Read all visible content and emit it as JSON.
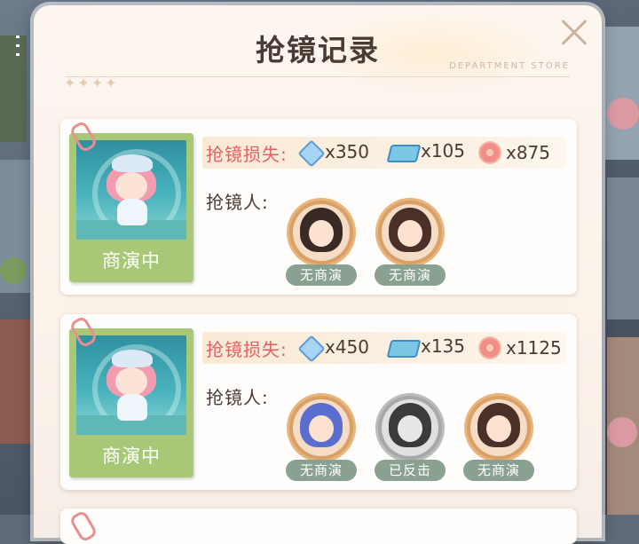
{
  "header": {
    "title": "抢镜记录",
    "subtitle": "DEPARTMENT STORE",
    "decoration": "✦✦✦✦"
  },
  "labels": {
    "loss": "抢镜损失:",
    "grabbers": "抢镜人:"
  },
  "resource_icons": [
    "crystal-icon",
    "cash-icon",
    "flower-icon"
  ],
  "records": [
    {
      "status": "商演中",
      "losses": [
        "x350",
        "x105",
        "x875"
      ],
      "grabbers": [
        {
          "tag": "无商演",
          "hair_color": "#3a2a25"
        },
        {
          "tag": "无商演",
          "hair_color": "#4a3029"
        }
      ]
    },
    {
      "status": "商演中",
      "losses": [
        "x450",
        "x135",
        "x1125"
      ],
      "grabbers": [
        {
          "tag": "无商演",
          "hair_color": "#5a6ed0"
        },
        {
          "tag": "已反击",
          "hair_color": "#3b3b3b"
        },
        {
          "tag": "无商演",
          "hair_color": "#4a3029"
        }
      ]
    }
  ],
  "colors": {
    "loss_label": "#e45f63",
    "tag_bg": "#8aa090",
    "photo_frame": "#a8c877"
  }
}
